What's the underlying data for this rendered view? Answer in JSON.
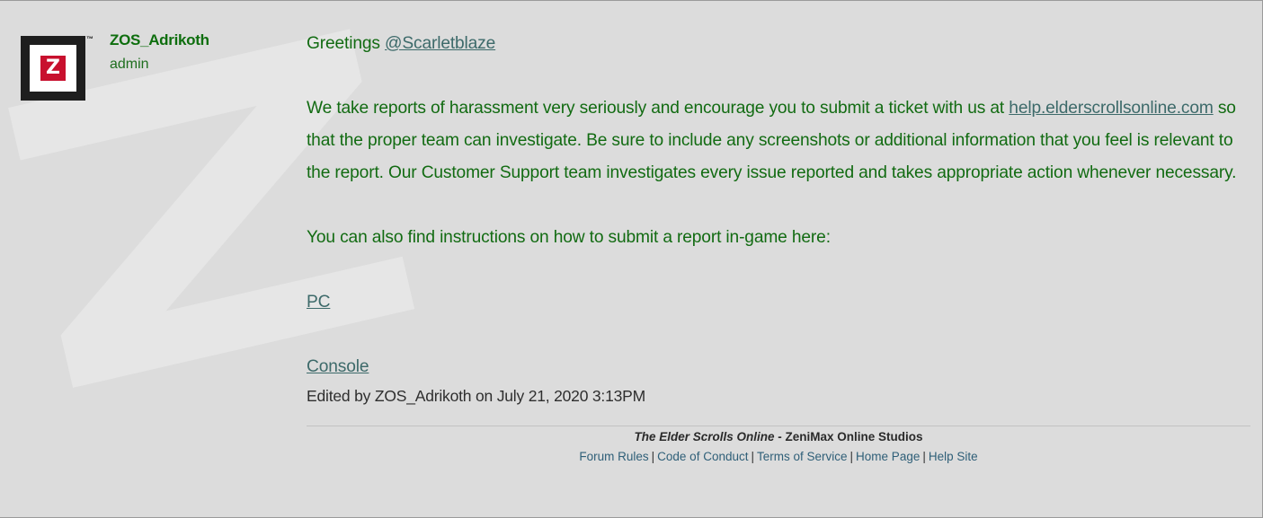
{
  "author": {
    "avatar_letter": "Z",
    "trademark": "™",
    "username": "ZOS_Adrikoth",
    "role": "admin"
  },
  "post": {
    "greeting": "Greetings ",
    "mention": "@Scarletblaze",
    "para1_before": "We take reports of harassment very seriously and encourage you to submit a ticket with us at ",
    "para1_link": "help.elderscrollsonline.com",
    "para1_after": " so that the proper team can investigate. Be sure to include any screenshots or additional information that you feel is relevant to the report. Our Customer Support team investigates every issue reported and takes appropriate action whenever necessary.",
    "para2": "You can also find instructions on how to submit a report in-game here:",
    "link_pc": "PC",
    "link_console": "Console",
    "edited": "Edited by ZOS_Adrikoth on July 21, 2020 3:13PM"
  },
  "footer": {
    "game_title": "The Elder Scrolls Online",
    "separator": " - ",
    "studio": "ZeniMax Online Studios",
    "links": [
      "Forum Rules",
      "Code of Conduct",
      "Terms of Service",
      "Home Page",
      "Help Site"
    ],
    "link_separator": "|"
  },
  "colors": {
    "background": "#dcdcdc",
    "post_text": "#126b12",
    "link": "#3d6a6a",
    "username": "#0e6e0e",
    "avatar_accent": "#c8102e"
  }
}
